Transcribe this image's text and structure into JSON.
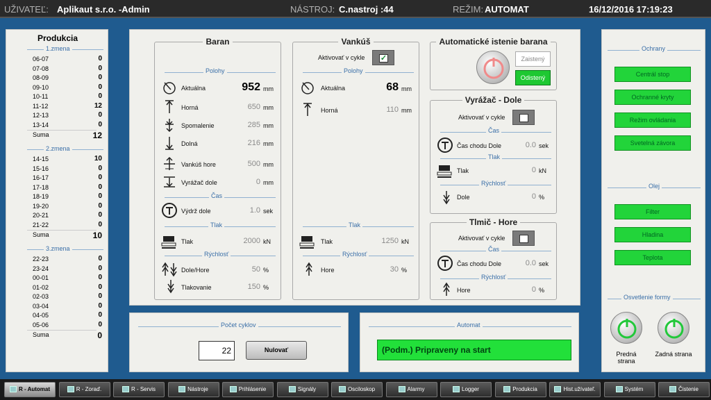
{
  "header": {
    "user_label": "UŽIVATEĽ:",
    "user_value": "Aplikaut s.r.o. -Admin",
    "tool_label": "NÁSTROJ:",
    "tool_value": "C.nastroj :44",
    "mode_label": "REŽIM:",
    "mode_value": "AUTOMAT",
    "datetime": "16/12/2016 17:19:23"
  },
  "production": {
    "title": "Produkcia",
    "shifts": [
      {
        "name": "1.zmena",
        "rows": [
          [
            "06-07",
            "0"
          ],
          [
            "07-08",
            "0"
          ],
          [
            "08-09",
            "0"
          ],
          [
            "09-10",
            "0"
          ],
          [
            "10-11",
            "0"
          ],
          [
            "11-12",
            "12"
          ],
          [
            "12-13",
            "0"
          ],
          [
            "13-14",
            "0"
          ]
        ],
        "sum_label": "Suma",
        "sum": "12"
      },
      {
        "name": "2.zmena",
        "rows": [
          [
            "14-15",
            "10"
          ],
          [
            "15-16",
            "0"
          ],
          [
            "16-17",
            "0"
          ],
          [
            "17-18",
            "0"
          ],
          [
            "18-19",
            "0"
          ],
          [
            "19-20",
            "0"
          ],
          [
            "20-21",
            "0"
          ],
          [
            "21-22",
            "0"
          ]
        ],
        "sum_label": "Suma",
        "sum": "10"
      },
      {
        "name": "3.zmena",
        "rows": [
          [
            "22-23",
            "0"
          ],
          [
            "23-24",
            "0"
          ],
          [
            "00-01",
            "0"
          ],
          [
            "01-02",
            "0"
          ],
          [
            "02-03",
            "0"
          ],
          [
            "03-04",
            "0"
          ],
          [
            "04-05",
            "0"
          ],
          [
            "05-06",
            "0"
          ]
        ],
        "sum_label": "Suma",
        "sum": "0"
      }
    ]
  },
  "baran": {
    "title": "Baran",
    "polohy": "Polohy",
    "aktualna_label": "Aktuálna",
    "aktualna": "952",
    "aktualna_unit": "mm",
    "horna_label": "Horná",
    "horna": "650",
    "horna_unit": "mm",
    "spomalenie_label": "Spomalenie",
    "spomalenie": "285",
    "spomalenie_unit": "mm",
    "dolna_label": "Dolná",
    "dolna": "216",
    "dolna_unit": "mm",
    "vankus_hore_label": "Vankúš hore",
    "vankus_hore": "500",
    "vankus_hore_unit": "mm",
    "vyrazac_dole_label": "Vyrážač dole",
    "vyrazac_dole": "0",
    "vyrazac_dole_unit": "mm",
    "cas": "Čas",
    "vydrz_label": "Výdrž dole",
    "vydrz": "1.0",
    "vydrz_unit": "sek",
    "tlak_sect": "Tlak",
    "tlak_label": "Tlak",
    "tlak": "2000",
    "tlak_unit": "kN",
    "rychlost": "Rýchlosť",
    "dole_hore_label": "Dole/Hore",
    "dole_hore": "50",
    "dole_hore_unit": "%",
    "tlakovanie_label": "Tlakovanie",
    "tlakovanie": "150",
    "tlakovanie_unit": "%"
  },
  "vankus": {
    "title": "Vankúš",
    "aktivovat_label": "Aktivovať v cykle",
    "aktivovat_checked": "✓",
    "polohy": "Polohy",
    "aktualna_label": "Aktuálna",
    "aktualna": "68",
    "aktualna_unit": "mm",
    "horna_label": "Horná",
    "horna": "110",
    "horna_unit": "mm",
    "tlak_sect": "Tlak",
    "tlak_label": "Tlak",
    "tlak": "1250",
    "tlak_unit": "kN",
    "rychlost": "Rýchlosť",
    "hore_label": "Hore",
    "hore": "30",
    "hore_unit": "%"
  },
  "istenie": {
    "title": "Automatické istenie barana",
    "zaisteny": "Zaistený",
    "odisteny": "Odistený"
  },
  "vyrazac": {
    "title": "Vyrážač - Dole",
    "aktivovat_label": "Aktivovať v cykle",
    "cas": "Čas",
    "cas_chodu_label": "Čas chodu Dole",
    "cas_chodu": "0.0",
    "cas_chodu_unit": "sek",
    "tlak_sect": "Tlak",
    "tlak_label": "Tlak",
    "tlak": "0",
    "tlak_unit": "kN",
    "rychlost": "Rýchlosť",
    "dole_label": "Dole",
    "dole": "0",
    "dole_unit": "%"
  },
  "tlmic": {
    "title": "Tlmič - Hore",
    "aktivovat_label": "Aktivovať v cykle",
    "cas": "Čas",
    "cas_chodu_label": "Čas chodu Dole",
    "cas_chodu": "0.0",
    "cas_chodu_unit": "sek",
    "rychlost": "Rýchlosť",
    "hore_label": "Hore",
    "hore": "0",
    "hore_unit": "%"
  },
  "pocet": {
    "title": "Počet cyklov",
    "value": "22",
    "reset": "Nulovať"
  },
  "automat": {
    "title": "Automat",
    "status": "(Podm.) Pripraveny na start"
  },
  "right": {
    "ochrany_title": "Ochrany",
    "ochrany": [
      "Centrál stop",
      "Ochranné kryty",
      "Režim ovládania",
      "Svetelná závora"
    ],
    "olej_title": "Olej",
    "olej": [
      "Filter",
      "Hladina",
      "Teplota"
    ],
    "osvetlenie_title": "Osvetlenie formy",
    "predna": "Predná strana",
    "zadna": "Zadná strana"
  },
  "taskbar": [
    "R - Automat",
    "R - Zoraď.",
    "R - Servis",
    "Nástroje",
    "Prihlásenie",
    "Signály",
    "Osciloskop",
    "Alarmy",
    "Logger",
    "Produkcia",
    "Hist.užívateľ.",
    "Systém",
    "Čistenie"
  ]
}
